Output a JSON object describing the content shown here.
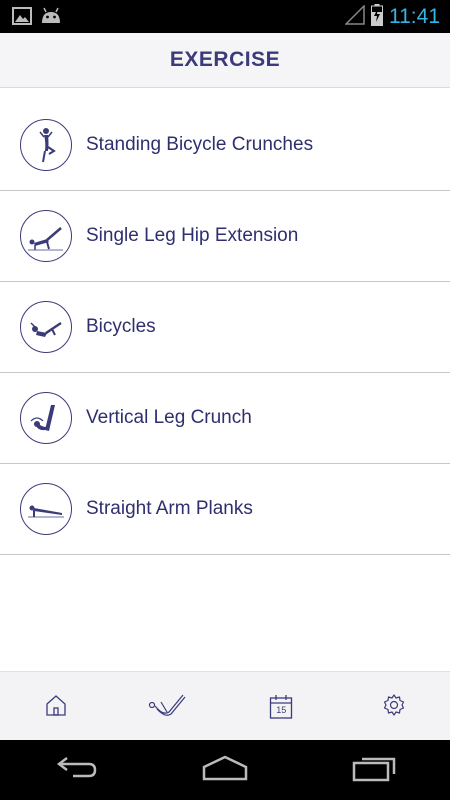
{
  "status_bar": {
    "time": "11:41",
    "icons": [
      "image-icon",
      "android-icon",
      "signal-icon",
      "battery-charging-icon"
    ]
  },
  "header": {
    "title": "EXERCISE"
  },
  "exercises": [
    {
      "name": "Standing Bicycle Crunches",
      "icon": "standing-figure-icon"
    },
    {
      "name": "Single Leg Hip Extension",
      "icon": "hip-extension-figure-icon"
    },
    {
      "name": "Bicycles",
      "icon": "bicycles-figure-icon"
    },
    {
      "name": "Vertical Leg Crunch",
      "icon": "leg-crunch-figure-icon"
    },
    {
      "name": "Straight Arm Planks",
      "icon": "plank-figure-icon"
    }
  ],
  "tab_bar": {
    "tabs": [
      "home-icon",
      "exercise-icon",
      "calendar-icon",
      "settings-icon"
    ],
    "calendar_day": "15"
  },
  "colors": {
    "accent": "#3b3b7a",
    "status_time": "#33b5e5",
    "header_bg": "#f5f5f7"
  }
}
